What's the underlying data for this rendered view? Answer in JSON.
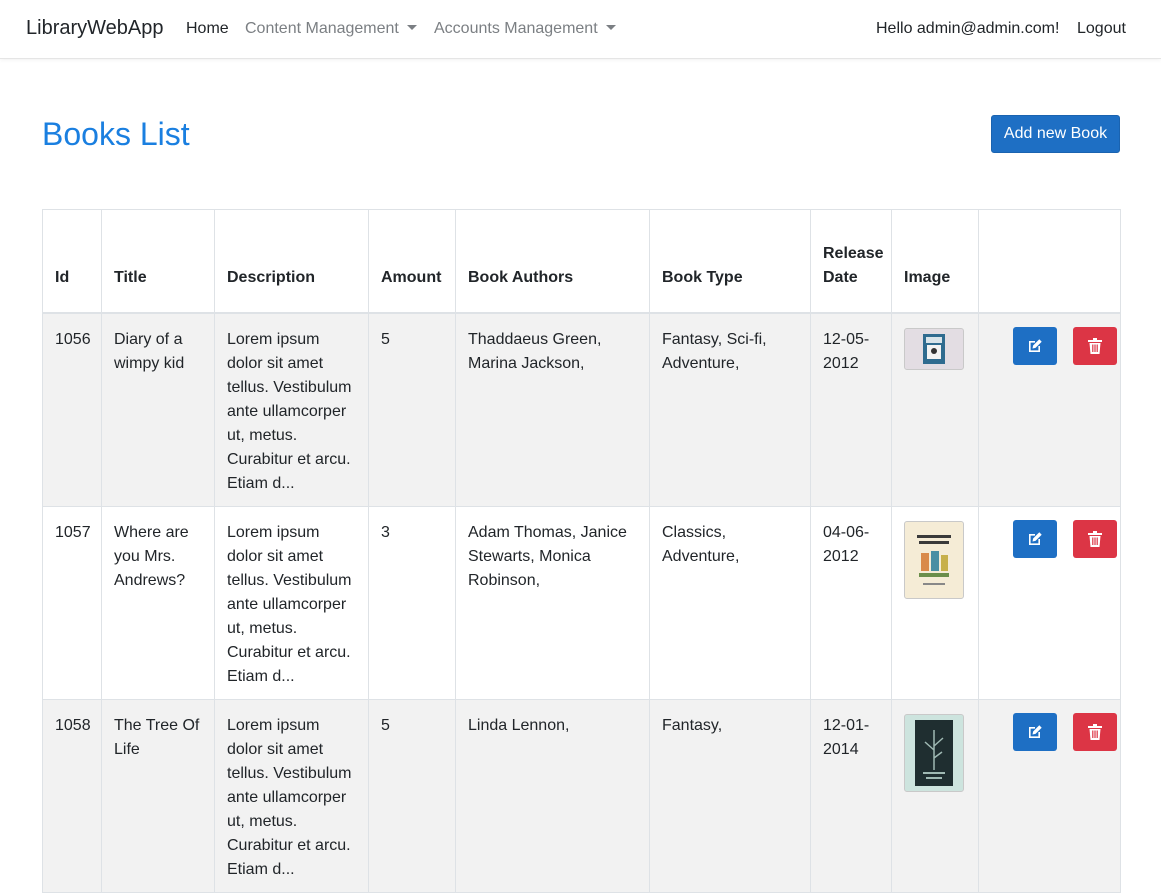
{
  "nav": {
    "brand": "LibraryWebApp",
    "home": "Home",
    "content_management": "Content Management",
    "accounts_management": "Accounts Management",
    "greeting": "Hello admin@admin.com!",
    "logout": "Logout"
  },
  "page": {
    "title": "Books List",
    "add_button": "Add new Book"
  },
  "table": {
    "headers": [
      "Id",
      "Title",
      "Description",
      "Amount",
      "Book Authors",
      "Book Type",
      "Release Date",
      "Image"
    ],
    "rows": [
      {
        "id": "1056",
        "title": "Diary of a wimpy kid",
        "description": "Lorem ipsum dolor sit amet tellus. Vestibulum ante ullamcorper ut, metus. Curabitur et arcu. Etiam d...",
        "amount": "5",
        "authors": "Thaddaeus Green, Marina Jackson,",
        "type": "Fantasy,  Sci-fi, Adventure,",
        "release_date": "12-05-2012",
        "image_icon": "book-cover-image"
      },
      {
        "id": "1057",
        "title": "Where are you Mrs. Andrews?",
        "description": "Lorem ipsum dolor sit amet tellus. Vestibulum ante ullamcorper ut, metus. Curabitur et arcu. Etiam d...",
        "amount": "3",
        "authors": "Adam Thomas, Janice Stewarts, Monica Robinson,",
        "type": "Classics, Adventure,",
        "release_date": "04-06-2012",
        "image_icon": "book-cover-image"
      },
      {
        "id": "1058",
        "title": "The Tree Of Life",
        "description": "Lorem ipsum dolor sit amet tellus. Vestibulum ante ullamcorper ut, metus. Curabitur et arcu. Etiam d...",
        "amount": "5",
        "authors": "Linda Lennon,",
        "type": "Fantasy,",
        "release_date": "12-01-2014",
        "image_icon": "book-cover-image"
      }
    ]
  },
  "colors": {
    "primary": "#1e6fc4",
    "title": "#1a7fe0",
    "danger": "#dc3545",
    "stripe": "#f2f2f2"
  },
  "icons": {
    "edit": "edit-icon",
    "delete": "trash-icon"
  }
}
